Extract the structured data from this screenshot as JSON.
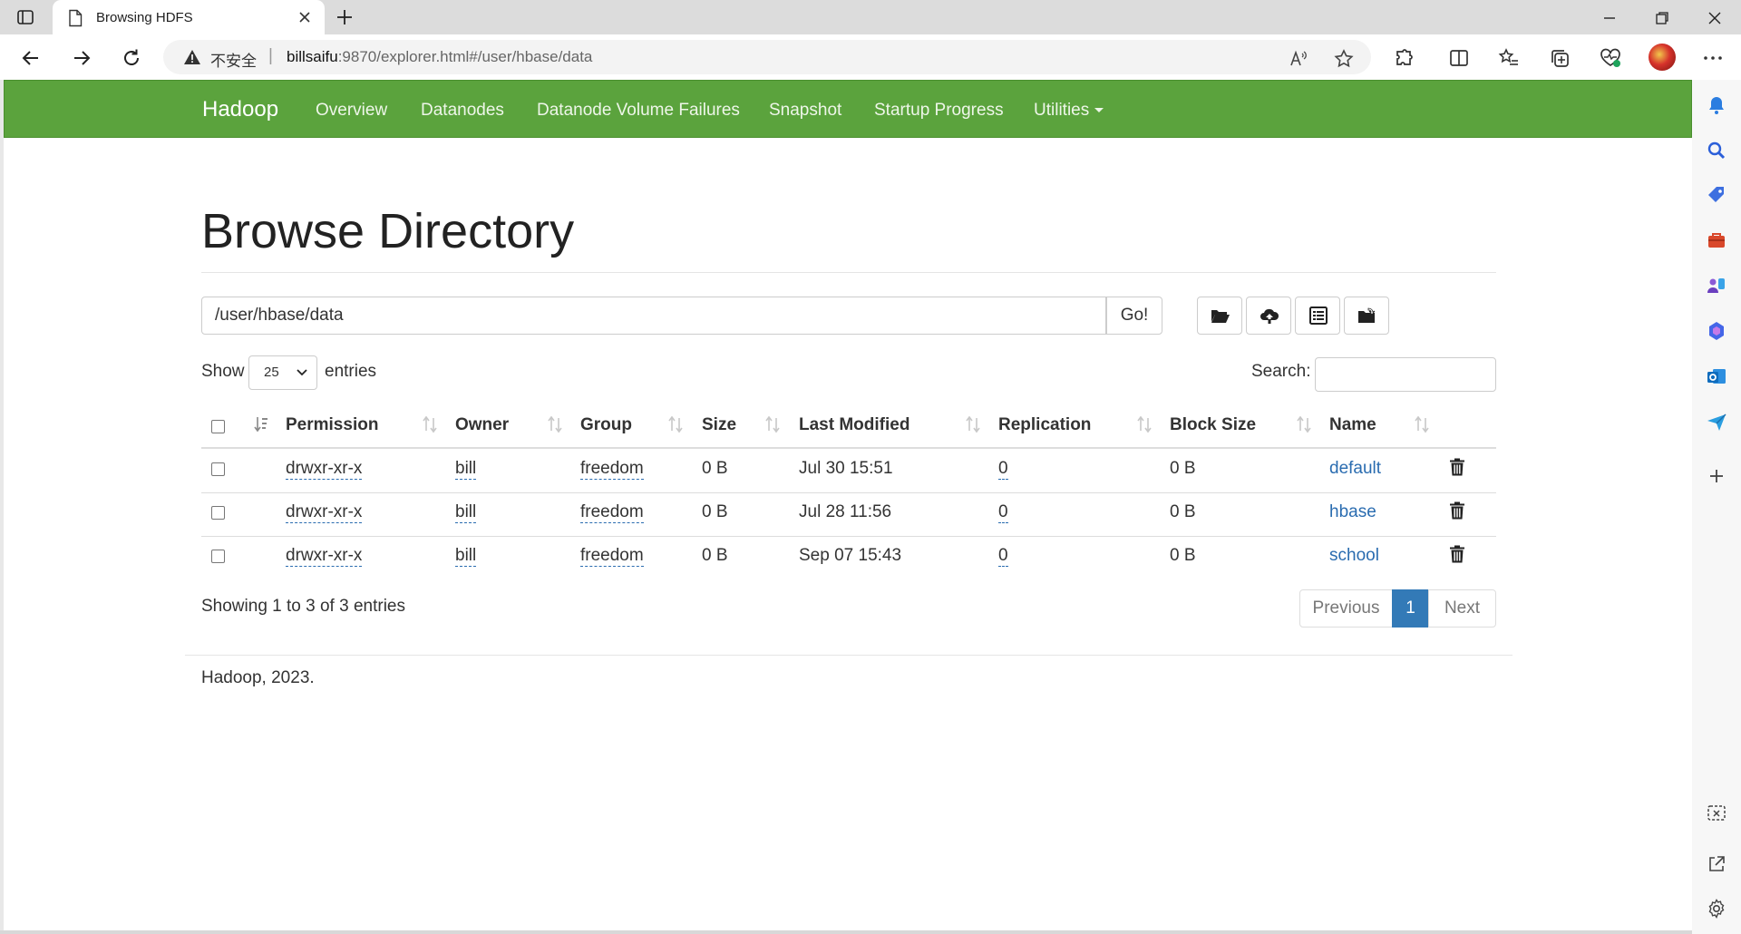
{
  "browser": {
    "tab_title": "Browsing HDFS",
    "security_label": "不安全",
    "url_host": "billsaifu",
    "url_rest": ":9870/explorer.html#/user/hbase/data"
  },
  "navbar": {
    "brand": "Hadoop",
    "links": [
      "Overview",
      "Datanodes",
      "Datanode Volume Failures",
      "Snapshot",
      "Startup Progress",
      "Utilities"
    ]
  },
  "page": {
    "title": "Browse Directory",
    "path_value": "/user/hbase/data",
    "go_label": "Go!",
    "show_label": "Show",
    "entries_value": "25",
    "entries_label": "entries",
    "search_label": "Search:"
  },
  "table": {
    "columns": [
      "Permission",
      "Owner",
      "Group",
      "Size",
      "Last Modified",
      "Replication",
      "Block Size",
      "Name"
    ],
    "rows": [
      {
        "permission": "drwxr-xr-x",
        "owner": "bill",
        "group": "freedom",
        "size": "0 B",
        "modified": "Jul 30 15:51",
        "replication": "0",
        "block_size": "0 B",
        "name": "default"
      },
      {
        "permission": "drwxr-xr-x",
        "owner": "bill",
        "group": "freedom",
        "size": "0 B",
        "modified": "Jul 28 11:56",
        "replication": "0",
        "block_size": "0 B",
        "name": "hbase"
      },
      {
        "permission": "drwxr-xr-x",
        "owner": "bill",
        "group": "freedom",
        "size": "0 B",
        "modified": "Sep 07 15:43",
        "replication": "0",
        "block_size": "0 B",
        "name": "school"
      }
    ]
  },
  "pagination": {
    "info": "Showing 1 to 3 of 3 entries",
    "previous": "Previous",
    "current": "1",
    "next": "Next"
  },
  "footer": {
    "text": "Hadoop, 2023."
  },
  "colors": {
    "navbar": "#5ba33d",
    "link": "#2a6cb0",
    "active_page": "#337ab7"
  }
}
